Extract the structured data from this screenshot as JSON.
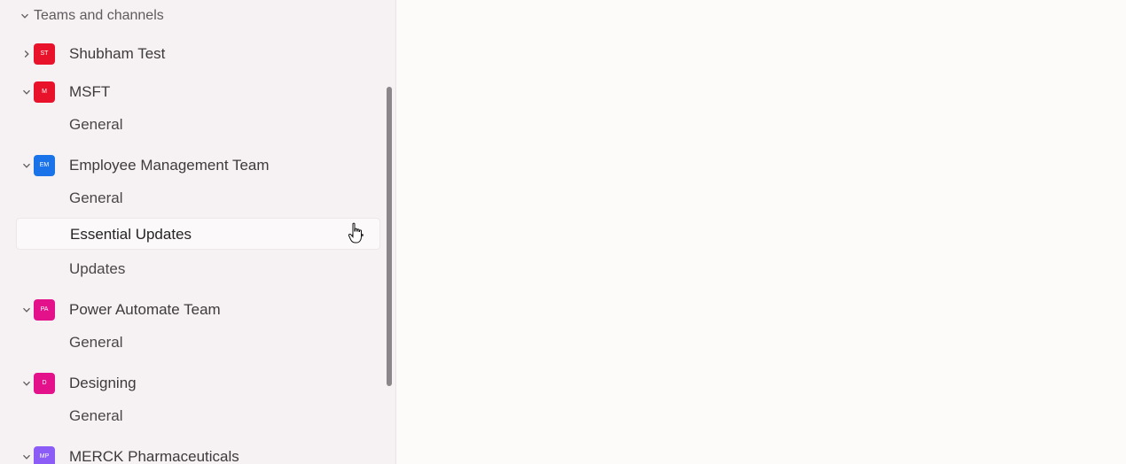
{
  "sidebar": {
    "section_title": "Teams and channels",
    "teams": [
      {
        "name": "Shubham Test",
        "initials": "ST",
        "color": "#e8132b",
        "expanded": false,
        "channels": []
      },
      {
        "name": "MSFT",
        "initials": "M",
        "color": "#e8132b",
        "expanded": true,
        "channels": [
          "General"
        ]
      },
      {
        "name": "Employee Management Team",
        "initials": "EM",
        "color": "#1a73e8",
        "expanded": true,
        "channels": [
          "General",
          "Essential Updates",
          "Updates"
        ]
      },
      {
        "name": "Power Automate Team",
        "initials": "PA",
        "color": "#e3118a",
        "expanded": true,
        "channels": [
          "General"
        ]
      },
      {
        "name": "Designing",
        "initials": "D",
        "color": "#e3118a",
        "expanded": true,
        "channels": [
          "General"
        ]
      },
      {
        "name": "MERCK Pharmaceuticals",
        "initials": "MP",
        "color": "#8b5cf6",
        "expanded": true,
        "channels": []
      }
    ],
    "selected_channel": "Essential Updates",
    "icons": {
      "chevron_down": "chevron-down-icon",
      "chevron_right": "chevron-right-icon",
      "more": "more-options-icon"
    }
  }
}
